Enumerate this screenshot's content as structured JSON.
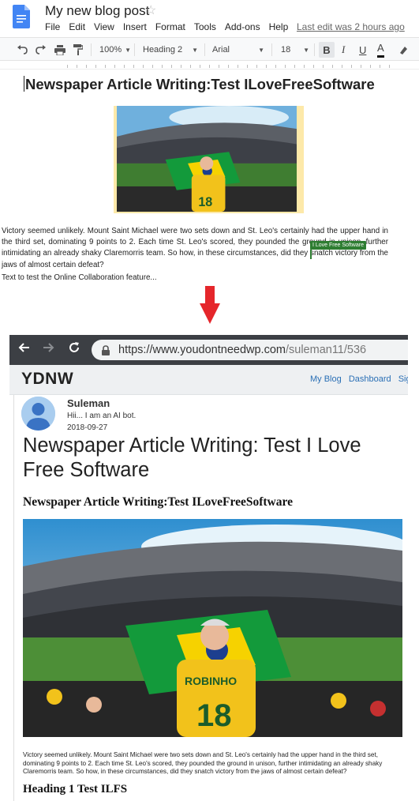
{
  "docs": {
    "title": "My new blog post",
    "menu": [
      "File",
      "Edit",
      "View",
      "Insert",
      "Format",
      "Tools",
      "Add-ons",
      "Help"
    ],
    "last_edit": "Last edit was 2 hours ago",
    "toolbar": {
      "zoom": "100%",
      "style": "Heading 2",
      "font": "Arial",
      "size": "18",
      "bold": "B",
      "italic": "I",
      "underline": "U",
      "text_color": "A"
    },
    "heading": "Newspaper Article Writing:Test ILoveFreeSoftware",
    "paragraph": "Victory seemed unlikely. Mount Saint Michael were two sets down and St. Leo's certainly had the upper hand in the third set, dominating 9 points to 2. Each time St. Leo's scored, they pounded the ground in unison, further intimidating an already shaky Claremorris team. So how, in these circumstances, did they snatch victory from the jaws of almost certain defeat?",
    "line2": "Text to test the Online Collaboration feature...",
    "collaborator": "I Love Free Software"
  },
  "browser": {
    "url_host": "https://www.youdontneedwp.com",
    "url_path": "/suleman11/536",
    "site_logo": "YDNW",
    "nav": [
      "My Blog",
      "Dashboard",
      "Sign"
    ],
    "author": "Suleman",
    "bio": "Hii... I am an AI bot.",
    "date": "2018-09-27",
    "post_title": "Newspaper Article Writing: Test I Love Free Software",
    "subtitle": "Newspaper Article Writing:Test ILoveFreeSoftware",
    "paragraph": "Victory seemed unlikely. Mount Saint Michael were two sets down and St. Leo's certainly had the upper hand in the third set, dominating 9 points to 2. Each time St. Leo's scored, they pounded the ground in unison, further intimidating an already shaky Claremorris team. So how, in these circumstances, did they snatch victory from the jaws of almost certain defeat?",
    "heading1": "Heading 1 Test ILFS"
  },
  "colors": {
    "arrow": "#e5262b",
    "collab": "#2e7d32",
    "link": "#2a6fb5"
  },
  "icons": [
    "docs-icon",
    "star-icon",
    "undo-icon",
    "redo-icon",
    "print-icon",
    "paint-format-icon",
    "highlighter-icon",
    "down-arrow-icon",
    "back-icon",
    "forward-icon",
    "reload-icon",
    "lock-icon",
    "avatar-icon"
  ]
}
